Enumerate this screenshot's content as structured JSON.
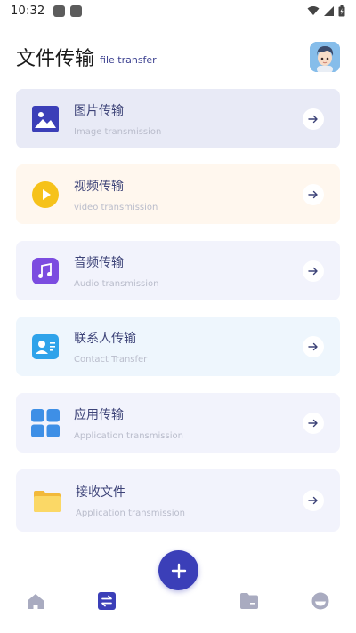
{
  "status": {
    "time": "10:32",
    "icons": [
      "notification-square-icon",
      "notification-square-icon",
      "wifi-icon",
      "signal-icon",
      "battery-icon"
    ]
  },
  "header": {
    "title": "文件传输",
    "subtitle": "file transfer",
    "avatar_icon": "avatar-cartoon-boy"
  },
  "cards": [
    {
      "title": "图片传输",
      "subtitle": "Image transmission",
      "icon": "image-icon",
      "bg": "#e8eaf6",
      "icon_color": "#3b3fb8"
    },
    {
      "title": "视频传输",
      "subtitle": "video transmission",
      "icon": "video-play-icon",
      "bg": "#fff7ee",
      "icon_color": "#f6c21a"
    },
    {
      "title": "音频传输",
      "subtitle": "Audio transmission",
      "icon": "music-note-icon",
      "bg": "#f2f3fc",
      "icon_color": "#7c4ce0"
    },
    {
      "title": "联系人传输",
      "subtitle": "Contact Transfer",
      "icon": "contact-card-icon",
      "bg": "#eef6fd",
      "icon_color": "#2fa3ea"
    },
    {
      "title": "应用传输",
      "subtitle": "Application transmission",
      "icon": "apps-grid-icon",
      "bg": "#f2f3fc",
      "icon_color": "#3e8fe6"
    },
    {
      "title": "接收文件",
      "subtitle": "Application transmission",
      "icon": "folder-icon",
      "bg": "#f2f3fc",
      "icon_color": "#f7cf52"
    }
  ],
  "nav": {
    "items": [
      "home-icon",
      "transfer-icon",
      "files-icon",
      "profile-icon"
    ],
    "active_index": 1,
    "fab_icon": "plus-icon",
    "active_color": "#3b3fb8",
    "inactive_color": "#a9abc0"
  }
}
